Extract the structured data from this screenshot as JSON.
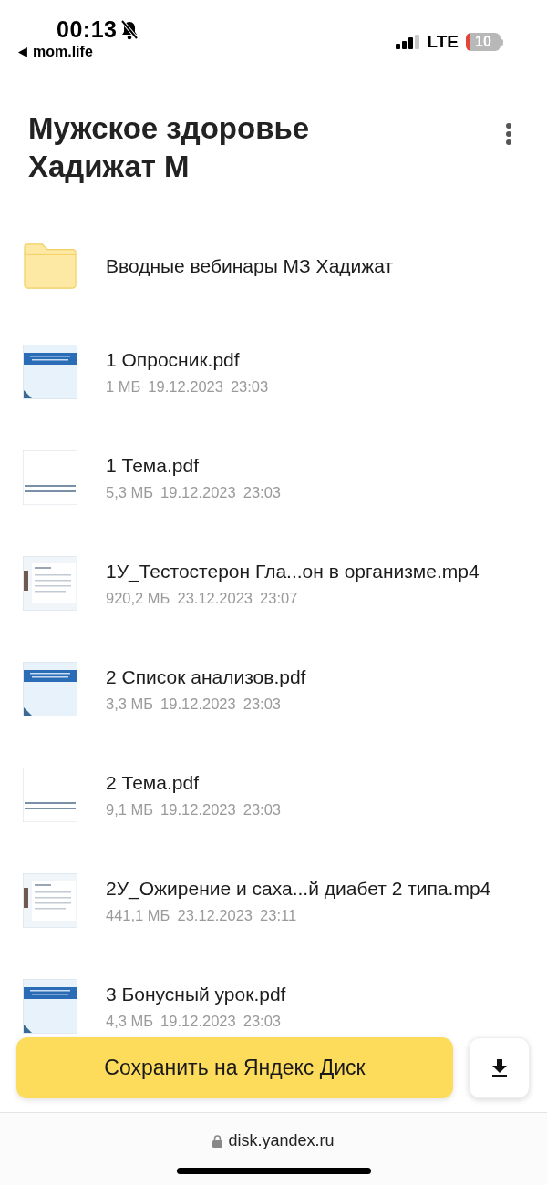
{
  "status_bar": {
    "time": "00:13",
    "silent": true,
    "back_app": "mom.life",
    "network": "LTE",
    "battery": "10"
  },
  "header": {
    "title": "Мужское здоровье Хадижат М"
  },
  "items": [
    {
      "kind": "folder",
      "name": "Вводные вебинары МЗ Хадижат"
    },
    {
      "kind": "document",
      "name": "1 Опросник.pdf",
      "size": "1 МБ",
      "date": "19.12.2023",
      "time": "23:03"
    },
    {
      "kind": "textpage",
      "name": "1 Тема.pdf",
      "size": "5,3 МБ",
      "date": "19.12.2023",
      "time": "23:03"
    },
    {
      "kind": "video",
      "name": "1У_Тестостерон Гла...он в организме.mp4",
      "size": "920,2 МБ",
      "date": "23.12.2023",
      "time": "23:07"
    },
    {
      "kind": "document",
      "name": "2 Список анализов.pdf",
      "size": "3,3 МБ",
      "date": "19.12.2023",
      "time": "23:03"
    },
    {
      "kind": "textpage",
      "name": "2 Тема.pdf",
      "size": "9,1 МБ",
      "date": "19.12.2023",
      "time": "23:03"
    },
    {
      "kind": "video",
      "name": "2У_Ожирение и саха...й диабет 2 типа.mp4",
      "size": "441,1 МБ",
      "date": "23.12.2023",
      "time": "23:11"
    },
    {
      "kind": "document",
      "name": "3 Бонусный урок.pdf",
      "size": "4,3 МБ",
      "date": "19.12.2023",
      "time": "23:03"
    }
  ],
  "actions": {
    "save_button": "Сохранить на Яндекс Диск"
  },
  "browser_bar": {
    "url": "disk.yandex.ru",
    "secure": true
  }
}
